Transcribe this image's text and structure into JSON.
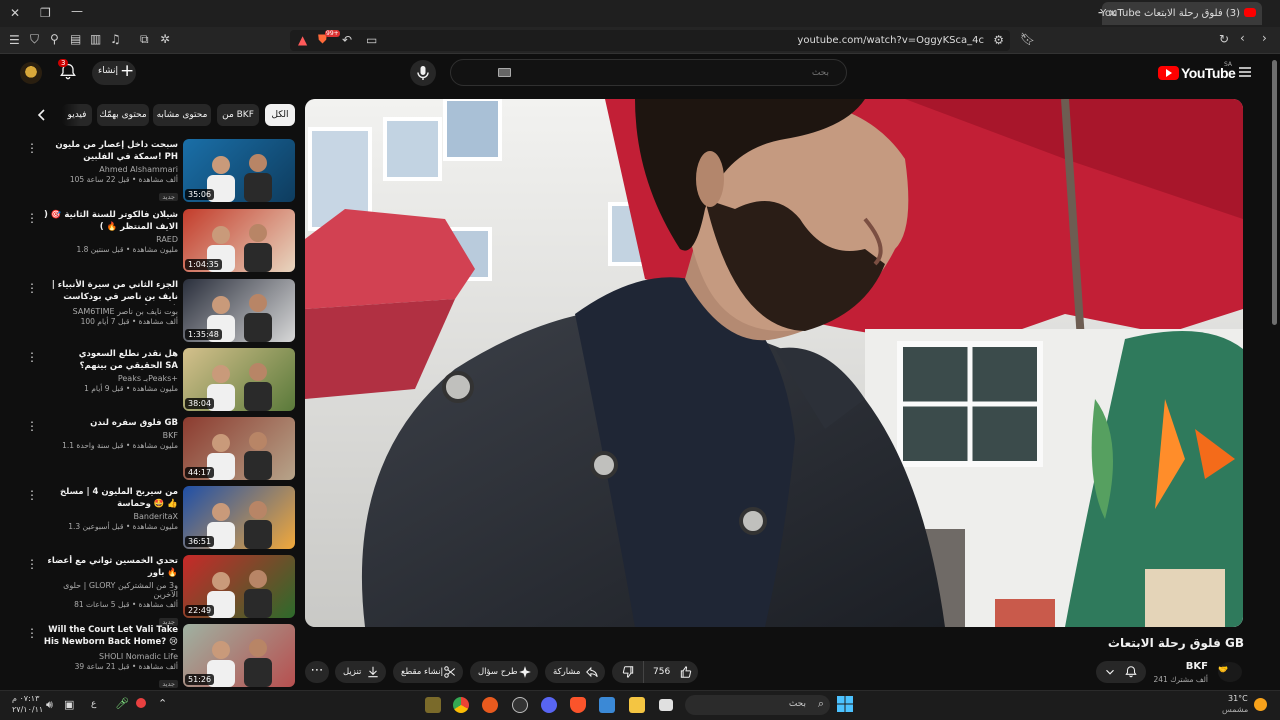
{
  "browser": {
    "tab_title": "(3) فلوق رحلة الابتعاث YouTube",
    "url": "youtube.com/watch?v=OggyKSca_4c",
    "shield_count": "99+"
  },
  "header": {
    "logo_text": "YouTube",
    "country_code": "SA",
    "search_placeholder": "بحث",
    "create_label": "إنشاء",
    "notification_count": "3"
  },
  "chips": [
    {
      "label": "الكل"
    },
    {
      "label": "من BKF"
    },
    {
      "label": "محتوى مشابه"
    },
    {
      "label": "محتوى بهمّك"
    },
    {
      "label": "فيديو"
    }
  ],
  "sidebar_videos": [
    {
      "title": "سبحت داخل إعصار من مليون سمكة في الفلبين! PH",
      "channel": "Ahmed Alshammari",
      "stats": "105 ألف مشاهدة • قبل 22 ساعة",
      "badge": "جديد",
      "duration": "35:06"
    },
    {
      "title": "شيلان فالكوتر للسنة الثانية 🎯 ( الايف المنتظر 🔥 )",
      "channel": "RAED",
      "stats": "1.8 مليون مشاهدة • قبل سنتين",
      "badge": "",
      "duration": "1:04:35"
    },
    {
      "title": "الجزء الثاني من سيرة الأنبياء | نايف بن ناصر في بودكاست نكهة سام",
      "channel": "SAM6TIME بوت نايف بن ناصر",
      "stats": "100 ألف مشاهدة • قبل 7 أيام",
      "badge": "",
      "duration": "1:35:48"
    },
    {
      "title": "هل نقدر نطلع السعودي الحقيقي من بينهم؟ SA",
      "channel": "Peaks بـPeaks+",
      "stats": "1 مليون مشاهدة • قبل 9 أيام",
      "badge": "",
      "duration": "38:04"
    },
    {
      "title": "فلوق سفره لندن GB",
      "channel": "BKF",
      "stats": "1.1 مليون مشاهدة • قبل سنة واحدة",
      "badge": "",
      "duration": "44:17"
    },
    {
      "title": "من سيربح المليون 4 | مسلخ وحماسة 🤩 👍",
      "channel": "BanderitaX",
      "stats": "1.3 مليون مشاهدة • قبل أسبوعين",
      "badge": "",
      "duration": "36:51"
    },
    {
      "title": "تحدي الخمسين ثواني مع أعضاء باور 🔥",
      "channel": "حلوى | GLORY و3 من المشتركين الآخرين",
      "stats": "81 ألف مشاهدة • قبل 5 ساعات",
      "badge": "جديد",
      "duration": "22:49"
    },
    {
      "title": "Will the Court Let Vali Take His Newborn Back Home? 😢 😮",
      "channel": "SHOLI Nomadic Life",
      "stats": "39 ألف مشاهدة • قبل 21 ساعة",
      "badge": "جديد",
      "duration": "51:26"
    }
  ],
  "video": {
    "title": "فلوق رحلة الابتعاث GB",
    "channel": "BKF",
    "subscribers": "241 ألف مشترك",
    "likes": "756",
    "share_label": "مشاركة",
    "ask_label": "طرح سؤال",
    "clip_label": "إنشاء مقطع",
    "download_label": "تنزيل"
  },
  "taskbar": {
    "search_placeholder": "بحث",
    "weather_temp": "31°C",
    "weather_desc": "مشمس",
    "time": "٠٧:١٣ م",
    "date": "٢٧/١٠/١١",
    "lang": "ع"
  }
}
